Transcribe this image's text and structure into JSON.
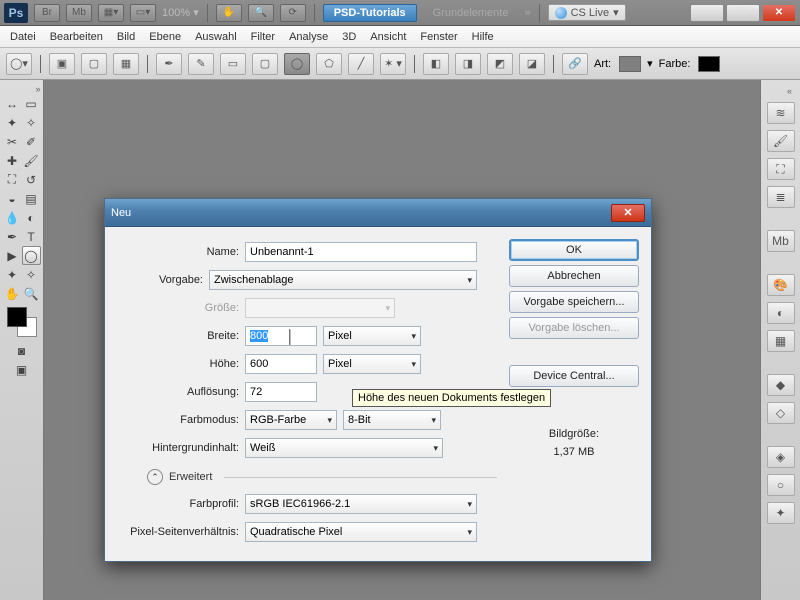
{
  "topbar": {
    "ps": "Ps",
    "br": "Br",
    "mb": "Mb",
    "zoom": "100%",
    "tab1": "PSD-Tutorials",
    "tab2": "Grundelemente",
    "cslive": "CS Live"
  },
  "menu": [
    "Datei",
    "Bearbeiten",
    "Bild",
    "Ebene",
    "Auswahl",
    "Filter",
    "Analyse",
    "3D",
    "Ansicht",
    "Fenster",
    "Hilfe"
  ],
  "optbar": {
    "art": "Art:",
    "farbe": "Farbe:"
  },
  "dialog": {
    "title": "Neu",
    "name_label": "Name:",
    "name_value": "Unbenannt-1",
    "preset_label": "Vorgabe:",
    "preset_value": "Zwischenablage",
    "size_label": "Größe:",
    "width_label": "Breite:",
    "width_value": "800",
    "width_unit": "Pixel",
    "height_label": "Höhe:",
    "height_value": "600",
    "height_unit": "Pixel",
    "res_label": "Auflösung:",
    "res_value": "72",
    "mode_label": "Farbmodus:",
    "mode_value": "RGB-Farbe",
    "depth_value": "8-Bit",
    "bg_label": "Hintergrundinhalt:",
    "bg_value": "Weiß",
    "advanced": "Erweitert",
    "profile_label": "Farbprofil:",
    "profile_value": "sRGB IEC61966-2.1",
    "pixel_label": "Pixel-Seitenverhältnis:",
    "pixel_value": "Quadratische Pixel",
    "ok": "OK",
    "cancel": "Abbrechen",
    "save_preset": "Vorgabe speichern...",
    "delete_preset": "Vorgabe löschen...",
    "device_central": "Device Central...",
    "filesize_label": "Bildgröße:",
    "filesize_value": "1,37 MB",
    "tooltip": "Höhe des neuen Dokuments festlegen"
  }
}
